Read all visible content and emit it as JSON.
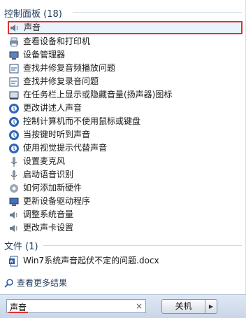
{
  "control_panel": {
    "title": "控制面板 (18)",
    "items": [
      {
        "label": "声音",
        "icon": "speaker-icon",
        "selected": true
      },
      {
        "label": "查看设备和打印机",
        "icon": "printer-icon"
      },
      {
        "label": "设备管理器",
        "icon": "device-manager-icon"
      },
      {
        "label": "查找并修复音频播放问题",
        "icon": "troubleshoot-icon"
      },
      {
        "label": "查找并修复录音问题",
        "icon": "troubleshoot-icon"
      },
      {
        "label": "在任务栏上显示或隐藏音量(扬声器)图标",
        "icon": "taskbar-icon"
      },
      {
        "label": "更改讲述人声音",
        "icon": "ease-of-access-icon"
      },
      {
        "label": "控制计算机而不使用鼠标或键盘",
        "icon": "ease-of-access-icon"
      },
      {
        "label": "当按键时听到声音",
        "icon": "ease-of-access-icon"
      },
      {
        "label": "使用视觉提示代替声音",
        "icon": "ease-of-access-icon"
      },
      {
        "label": "设置麦克风",
        "icon": "microphone-icon"
      },
      {
        "label": "启动语音识别",
        "icon": "microphone-icon"
      },
      {
        "label": "如何添加新硬件",
        "icon": "hardware-icon"
      },
      {
        "label": "更新设备驱动程序",
        "icon": "driver-icon"
      },
      {
        "label": "调整系统音量",
        "icon": "speaker-icon"
      },
      {
        "label": "更改声卡设置",
        "icon": "speaker-icon"
      }
    ]
  },
  "files": {
    "title": "文件 (1)",
    "items": [
      {
        "label": "Win7系统声音起伏不定的问题.docx",
        "icon": "word-document-icon"
      }
    ]
  },
  "more_results": {
    "label": "查看更多结果",
    "icon": "search-icon"
  },
  "search": {
    "value": "声音",
    "clear": "×"
  },
  "shutdown": {
    "label": "关机",
    "arrow": "▶"
  },
  "colors": {
    "highlight_border": "#e0302e",
    "header_text": "#1e395b"
  }
}
